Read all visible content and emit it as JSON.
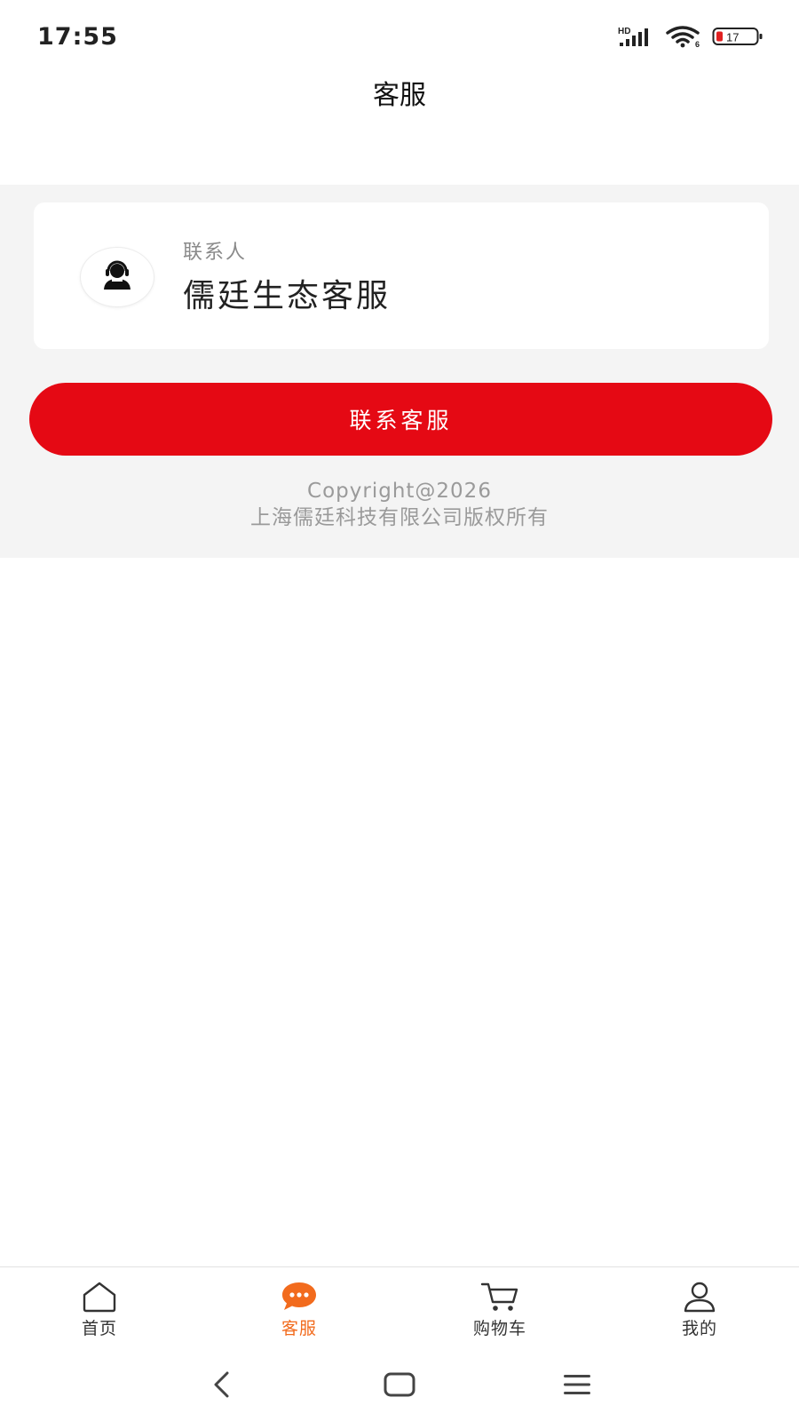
{
  "status_bar": {
    "time": "17:55",
    "network_label": "HD",
    "wifi_label": "6",
    "battery_level": "17",
    "icons": [
      "signal-icon",
      "wifi-icon",
      "battery-icon"
    ]
  },
  "header": {
    "title": "客服"
  },
  "contact_card": {
    "label": "联系人",
    "name": "儒廷生态客服",
    "avatar_icon": "customer-service-agent-icon"
  },
  "contact_button": {
    "label": "联系客服",
    "color": "#e50914"
  },
  "copyright": {
    "line1": "Copyright@2026",
    "line2": "上海儒廷科技有限公司版权所有"
  },
  "tab_bar": {
    "active_color": "#f26b1d",
    "tabs": [
      {
        "label": "首页",
        "icon": "home-icon",
        "active": false
      },
      {
        "label": "客服",
        "icon": "chat-bubble-icon",
        "active": true
      },
      {
        "label": "购物车",
        "icon": "cart-icon",
        "active": false
      },
      {
        "label": "我的",
        "icon": "profile-icon",
        "active": false
      }
    ]
  },
  "system_nav": {
    "icons": [
      "back-icon",
      "home-square-icon",
      "menu-icon"
    ]
  }
}
